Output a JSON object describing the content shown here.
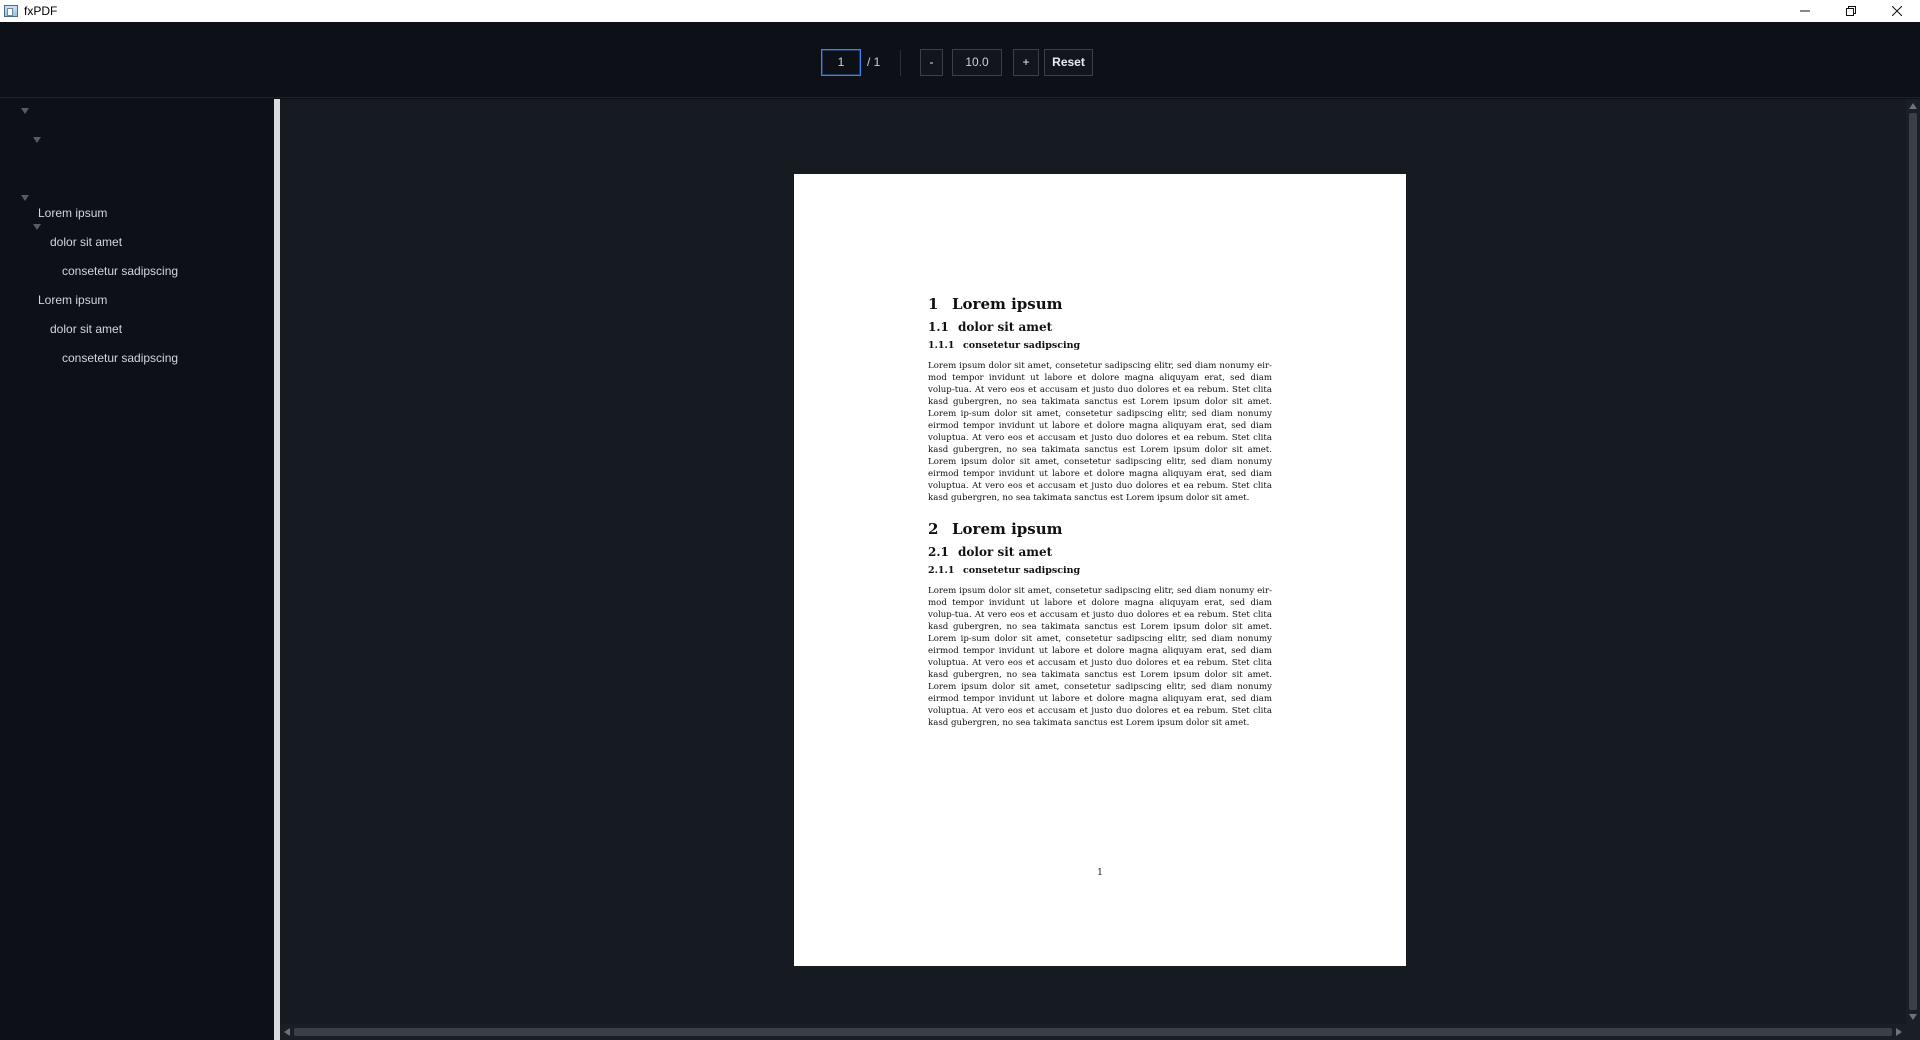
{
  "window": {
    "title": "fxPDF"
  },
  "toolbar": {
    "page_current": "1",
    "page_total": "/ 1",
    "zoom_out_label": "-",
    "zoom_value": "10.0",
    "zoom_in_label": "+",
    "reset_label": "Reset"
  },
  "outline": {
    "items": [
      {
        "label": "Lorem ipsum",
        "level": 0,
        "expanded": true
      },
      {
        "label": "dolor sit amet",
        "level": 1,
        "expanded": true
      },
      {
        "label": "consetetur sadipscing",
        "level": 2,
        "expanded": false
      },
      {
        "label": "Lorem ipsum",
        "level": 0,
        "expanded": true
      },
      {
        "label": "dolor sit amet",
        "level": 1,
        "expanded": true
      },
      {
        "label": "consetetur sadipscing",
        "level": 2,
        "expanded": false
      }
    ]
  },
  "document": {
    "sections": [
      {
        "num": "1",
        "title": "Lorem ipsum",
        "sub_num": "1.1",
        "sub_title": "dolor sit amet",
        "subsub_num": "1.1.1",
        "subsub_title": "consetetur sadipscing",
        "body": "Lorem ipsum dolor sit amet, consetetur sadipscing elitr, sed diam nonumy eir-mod tempor invidunt ut labore et dolore magna aliquyam erat, sed diam volup-tua. At vero eos et accusam et justo duo dolores et ea rebum. Stet clita kasd gubergren, no sea takimata sanctus est Lorem ipsum dolor sit amet. Lorem ip-sum dolor sit amet, consetetur sadipscing elitr, sed diam nonumy eirmod tempor invidunt ut labore et dolore magna aliquyam erat, sed diam voluptua. At vero eos et accusam et justo duo dolores et ea rebum. Stet clita kasd gubergren, no sea takimata sanctus est Lorem ipsum dolor sit amet. Lorem ipsum dolor sit amet, consetetur sadipscing elitr, sed diam nonumy eirmod tempor invidunt ut labore et dolore magna aliquyam erat, sed diam voluptua. At vero eos et accusam et justo duo dolores et ea rebum. Stet clita kasd gubergren, no sea takimata sanctus est Lorem ipsum dolor sit amet."
      },
      {
        "num": "2",
        "title": "Lorem ipsum",
        "sub_num": "2.1",
        "sub_title": "dolor sit amet",
        "subsub_num": "2.1.1",
        "subsub_title": "consetetur sadipscing",
        "body": "Lorem ipsum dolor sit amet, consetetur sadipscing elitr, sed diam nonumy eir-mod tempor invidunt ut labore et dolore magna aliquyam erat, sed diam volup-tua. At vero eos et accusam et justo duo dolores et ea rebum. Stet clita kasd gubergren, no sea takimata sanctus est Lorem ipsum dolor sit amet. Lorem ip-sum dolor sit amet, consetetur sadipscing elitr, sed diam nonumy eirmod tempor invidunt ut labore et dolore magna aliquyam erat, sed diam voluptua. At vero eos et accusam et justo duo dolores et ea rebum. Stet clita kasd gubergren, no sea takimata sanctus est Lorem ipsum dolor sit amet. Lorem ipsum dolor sit amet, consetetur sadipscing elitr, sed diam nonumy eirmod tempor invidunt ut labore et dolore magna aliquyam erat, sed diam voluptua. At vero eos et accusam et justo duo dolores et ea rebum. Stet clita kasd gubergren, no sea takimata sanctus est Lorem ipsum dolor sit amet."
      }
    ],
    "page_number": "1"
  }
}
